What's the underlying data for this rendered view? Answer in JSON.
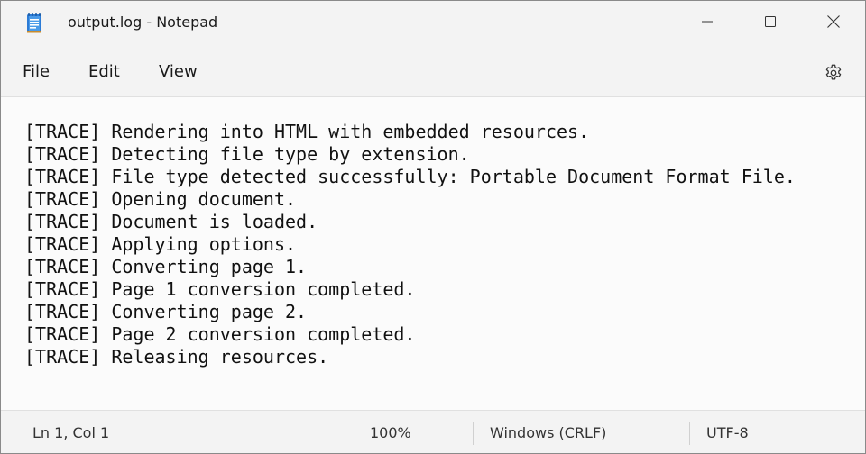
{
  "window": {
    "title": "output.log - Notepad"
  },
  "menu": {
    "file": "File",
    "edit": "Edit",
    "view": "View"
  },
  "icons": {
    "app": "notepad-icon",
    "minimize": "minimize-icon",
    "maximize": "maximize-icon",
    "close": "close-icon",
    "settings": "gear-icon"
  },
  "editor": {
    "lines": [
      "[TRACE] Rendering into HTML with embedded resources.",
      "[TRACE] Detecting file type by extension.",
      "[TRACE] File type detected successfully: Portable Document Format File.",
      "[TRACE] Opening document.",
      "[TRACE] Document is loaded.",
      "[TRACE] Applying options.",
      "[TRACE] Converting page 1.",
      "[TRACE] Page 1 conversion completed.",
      "[TRACE] Converting page 2.",
      "[TRACE] Page 2 conversion completed.",
      "[TRACE] Releasing resources."
    ]
  },
  "status": {
    "position": "Ln 1, Col 1",
    "zoom": "100%",
    "line_ending": "Windows (CRLF)",
    "encoding": "UTF-8"
  },
  "colors": {
    "accent": "#2b7bd6",
    "background": "#f3f3f3",
    "editor_background": "#fbfbfb"
  }
}
